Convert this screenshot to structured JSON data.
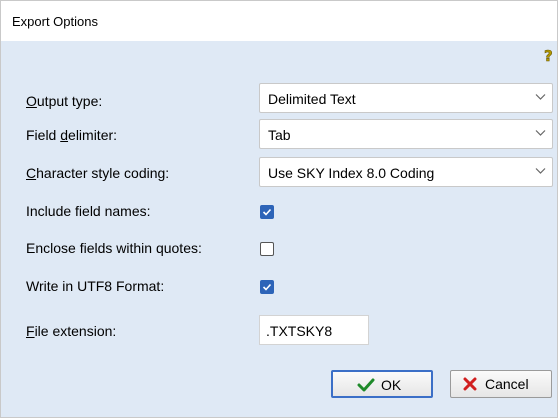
{
  "window": {
    "title": "Export Options"
  },
  "fields": {
    "output_type": {
      "label_accel": "O",
      "label_rest": "utput type:",
      "value": "Delimited Text"
    },
    "field_delimiter": {
      "label_pre": "Field ",
      "label_accel": "d",
      "label_rest": "elimiter:",
      "value": "Tab"
    },
    "char_style_coding": {
      "label_accel": "C",
      "label_rest": "haracter style coding:",
      "value": "Use SKY Index 8.0 Coding"
    },
    "include_field_names": {
      "label": "Include field names:",
      "checked": true
    },
    "enclose_quotes": {
      "label": "Enclose fields within quotes:",
      "checked": false
    },
    "write_utf8": {
      "label": "Write in UTF8 Format:",
      "checked": true
    },
    "file_extension": {
      "label_accel": "F",
      "label_rest": "ile extension:",
      "value": ".TXTSKY8"
    }
  },
  "buttons": {
    "ok_label": "OK",
    "cancel_label": "Cancel"
  },
  "colors": {
    "client_bg": "#dfe9f5",
    "checkbox_checked": "#2d64b8",
    "ok_check_green": "#1f8a2a",
    "cancel_x_red": "#d11f1f"
  },
  "icons": {
    "help": "question-key-icon",
    "ok": "checkmark-icon",
    "cancel": "red-x-icon",
    "dropdown": "chevron-down-icon"
  }
}
